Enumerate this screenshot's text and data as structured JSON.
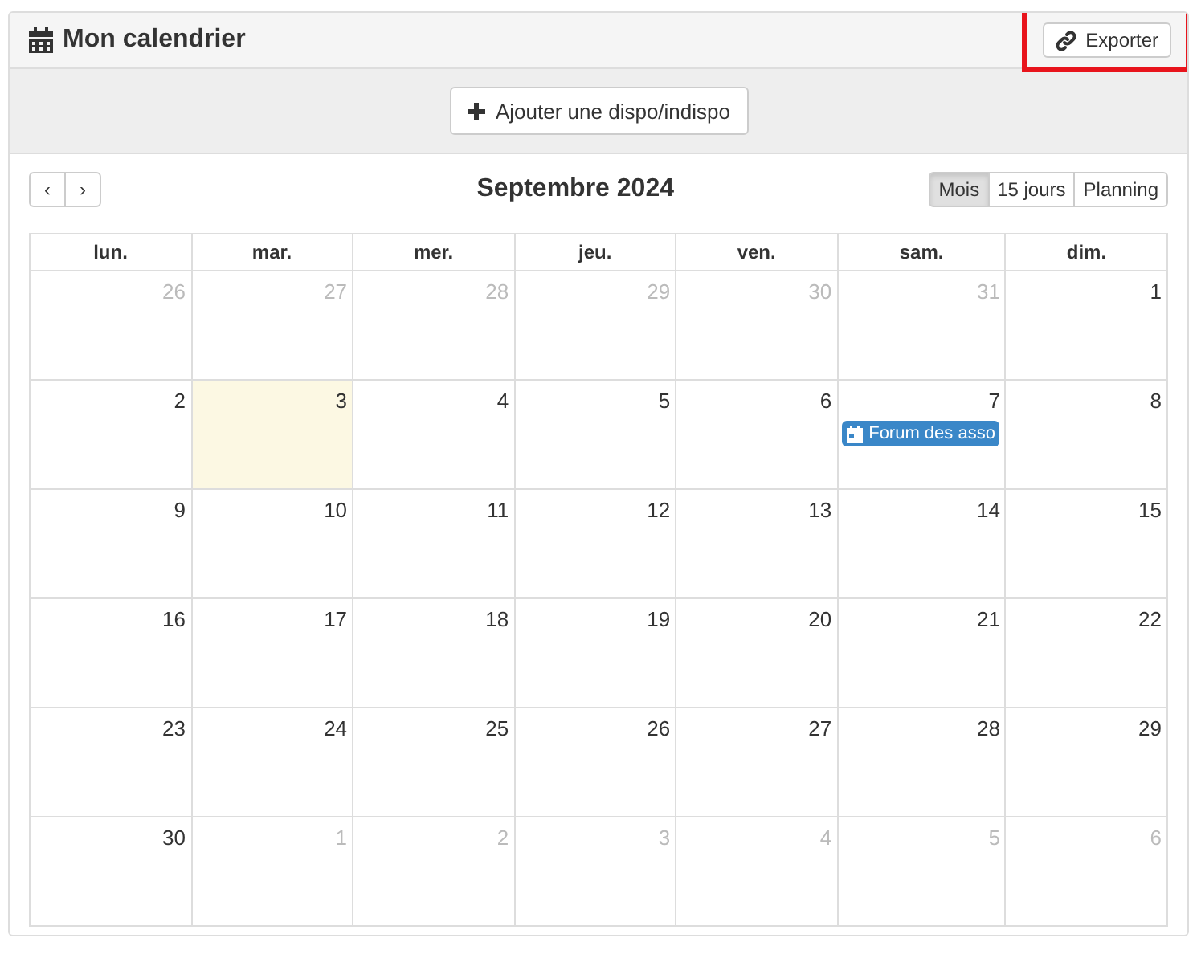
{
  "panel": {
    "title": "Mon calendrier",
    "export_button": "Exporter",
    "export_highlighted": true
  },
  "toolbar": {
    "add_button": "Ajouter une dispo/indispo"
  },
  "calendar": {
    "prev": "‹",
    "next": "›",
    "title": "Septembre 2024",
    "views": [
      {
        "label": "Mois",
        "selected": true
      },
      {
        "label": "15 jours",
        "selected": false
      },
      {
        "label": "Planning",
        "selected": false
      }
    ],
    "weekdays": [
      "lun.",
      "mar.",
      "mer.",
      "jeu.",
      "ven.",
      "sam.",
      "dim."
    ],
    "weeks": [
      [
        {
          "day": "26",
          "other_month": true,
          "today": false
        },
        {
          "day": "27",
          "other_month": true,
          "today": false
        },
        {
          "day": "28",
          "other_month": true,
          "today": false
        },
        {
          "day": "29",
          "other_month": true,
          "today": false
        },
        {
          "day": "30",
          "other_month": true,
          "today": false
        },
        {
          "day": "31",
          "other_month": true,
          "today": false
        },
        {
          "day": "1",
          "other_month": false,
          "today": false
        }
      ],
      [
        {
          "day": "2",
          "other_month": false,
          "today": false
        },
        {
          "day": "3",
          "other_month": false,
          "today": true
        },
        {
          "day": "4",
          "other_month": false,
          "today": false
        },
        {
          "day": "5",
          "other_month": false,
          "today": false
        },
        {
          "day": "6",
          "other_month": false,
          "today": false
        },
        {
          "day": "7",
          "other_month": false,
          "today": false,
          "events": [
            {
              "title": "Forum des asso"
            }
          ]
        },
        {
          "day": "8",
          "other_month": false,
          "today": false
        }
      ],
      [
        {
          "day": "9",
          "other_month": false,
          "today": false
        },
        {
          "day": "10",
          "other_month": false,
          "today": false
        },
        {
          "day": "11",
          "other_month": false,
          "today": false
        },
        {
          "day": "12",
          "other_month": false,
          "today": false
        },
        {
          "day": "13",
          "other_month": false,
          "today": false
        },
        {
          "day": "14",
          "other_month": false,
          "today": false
        },
        {
          "day": "15",
          "other_month": false,
          "today": false
        }
      ],
      [
        {
          "day": "16",
          "other_month": false,
          "today": false
        },
        {
          "day": "17",
          "other_month": false,
          "today": false
        },
        {
          "day": "18",
          "other_month": false,
          "today": false
        },
        {
          "day": "19",
          "other_month": false,
          "today": false
        },
        {
          "day": "20",
          "other_month": false,
          "today": false
        },
        {
          "day": "21",
          "other_month": false,
          "today": false
        },
        {
          "day": "22",
          "other_month": false,
          "today": false
        }
      ],
      [
        {
          "day": "23",
          "other_month": false,
          "today": false
        },
        {
          "day": "24",
          "other_month": false,
          "today": false
        },
        {
          "day": "25",
          "other_month": false,
          "today": false
        },
        {
          "day": "26",
          "other_month": false,
          "today": false
        },
        {
          "day": "27",
          "other_month": false,
          "today": false
        },
        {
          "day": "28",
          "other_month": false,
          "today": false
        },
        {
          "day": "29",
          "other_month": false,
          "today": false
        }
      ],
      [
        {
          "day": "30",
          "other_month": false,
          "today": false
        },
        {
          "day": "1",
          "other_month": true,
          "today": false
        },
        {
          "day": "2",
          "other_month": true,
          "today": false
        },
        {
          "day": "3",
          "other_month": true,
          "today": false
        },
        {
          "day": "4",
          "other_month": true,
          "today": false
        },
        {
          "day": "5",
          "other_month": true,
          "today": false
        },
        {
          "day": "6",
          "other_month": true,
          "today": false
        }
      ]
    ]
  }
}
